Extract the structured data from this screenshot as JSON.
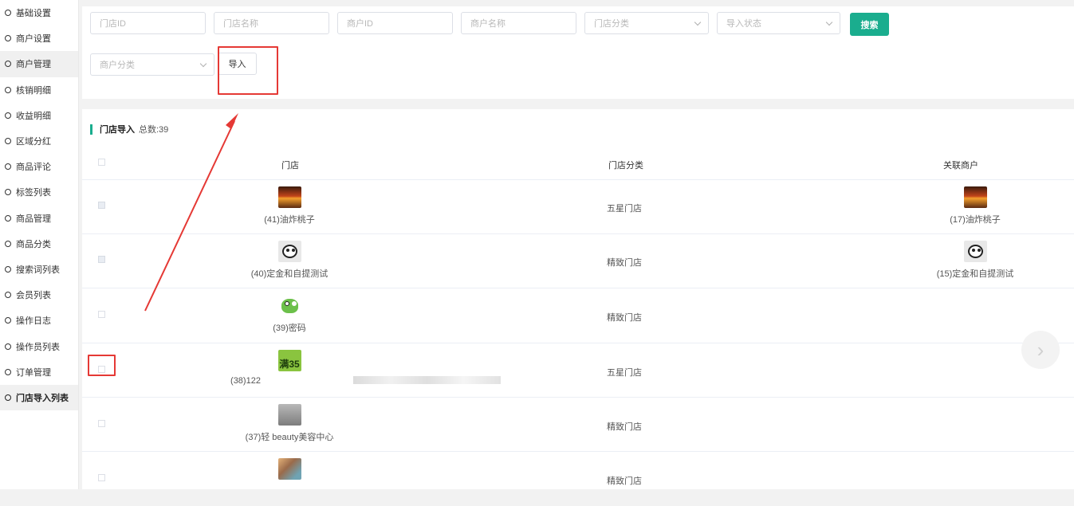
{
  "sidebar": {
    "items": [
      {
        "label": "基础设置"
      },
      {
        "label": "商户设置"
      },
      {
        "label": "商户管理"
      },
      {
        "label": "核销明细"
      },
      {
        "label": "收益明细"
      },
      {
        "label": "区域分红"
      },
      {
        "label": "商品评论"
      },
      {
        "label": "标签列表"
      },
      {
        "label": "商品管理"
      },
      {
        "label": "商品分类"
      },
      {
        "label": "搜索词列表"
      },
      {
        "label": "会员列表"
      },
      {
        "label": "操作日志"
      },
      {
        "label": "操作员列表"
      },
      {
        "label": "订单管理"
      },
      {
        "label": "门店导入列表"
      }
    ]
  },
  "filters": {
    "store_id_placeholder": "门店ID",
    "store_name_placeholder": "门店名称",
    "merchant_id_placeholder": "商户ID",
    "merchant_name_placeholder": "商户名称",
    "store_category_placeholder": "门店分类",
    "import_status_placeholder": "导入状态",
    "merchant_category_placeholder": "商户分类",
    "search_label": "搜索",
    "import_label": "导入"
  },
  "section": {
    "title": "门店导入",
    "total": "总数:39"
  },
  "table": {
    "headers": {
      "store": "门店",
      "category": "门店分类",
      "merchant": "关联商户"
    },
    "rows": [
      {
        "store": "(41)油炸桃子",
        "category": "五星门店",
        "merchant": "(17)油炸桃子",
        "thumb": "sunset-image",
        "merchant_thumb": "sunset-image"
      },
      {
        "store": "(40)定金和自提测试",
        "category": "精致门店",
        "merchant": "(15)定金和自提测试",
        "thumb": "panda-image",
        "merchant_thumb": "panda-image"
      },
      {
        "store": "(39)密码",
        "category": "精致门店",
        "merchant": "",
        "thumb": "frog-image"
      },
      {
        "store": "(38)122",
        "category": "五星门店",
        "merchant": "",
        "thumb": "promo-image",
        "thumb_text": "满35"
      },
      {
        "store": "(37)轻 beauty美容中心",
        "category": "精致门店",
        "merchant": "",
        "thumb": "grey-image"
      },
      {
        "store": "",
        "category": "精致门店",
        "merchant": "",
        "thumb": "photo-image"
      }
    ]
  },
  "colors": {
    "accent": "#1aad8e",
    "annotation_red": "#e53935"
  }
}
